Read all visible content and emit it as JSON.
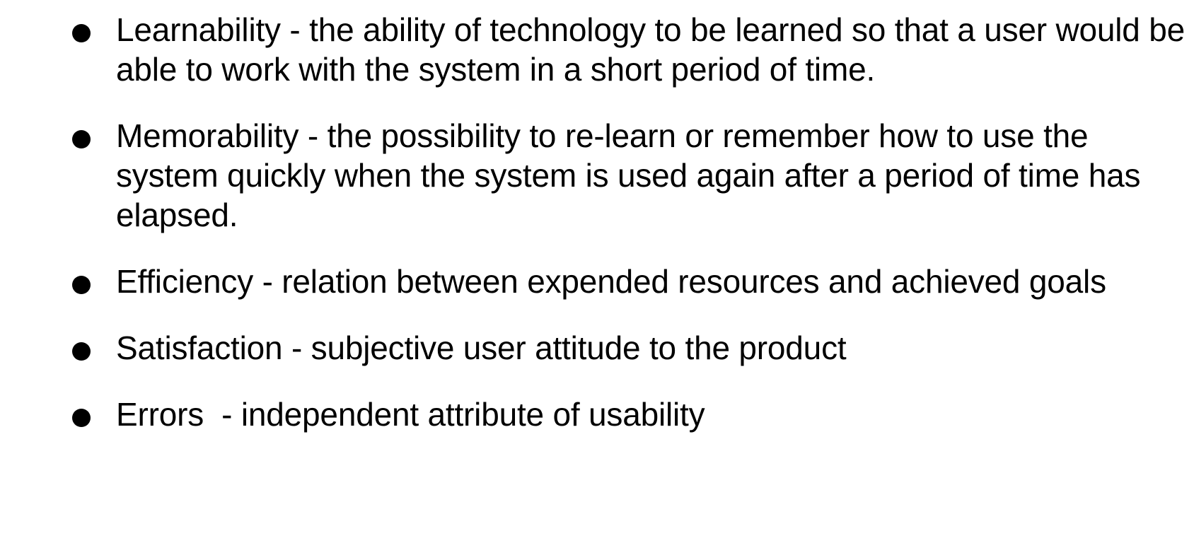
{
  "bullets": [
    {
      "text": "Learnability - the ability of technology to be learned so that a user would be able to work with the system in a short period of time."
    },
    {
      "text": "Memorability - the possibility to re-learn or remember how to use the system quickly when the system is used again after a period of time has elapsed."
    },
    {
      "text": "Efficiency - relation between expended resources and achieved goals"
    },
    {
      "text": "Satisfaction - subjective user attitude to the product"
    },
    {
      "text": "Errors  - independent attribute of usability"
    }
  ]
}
